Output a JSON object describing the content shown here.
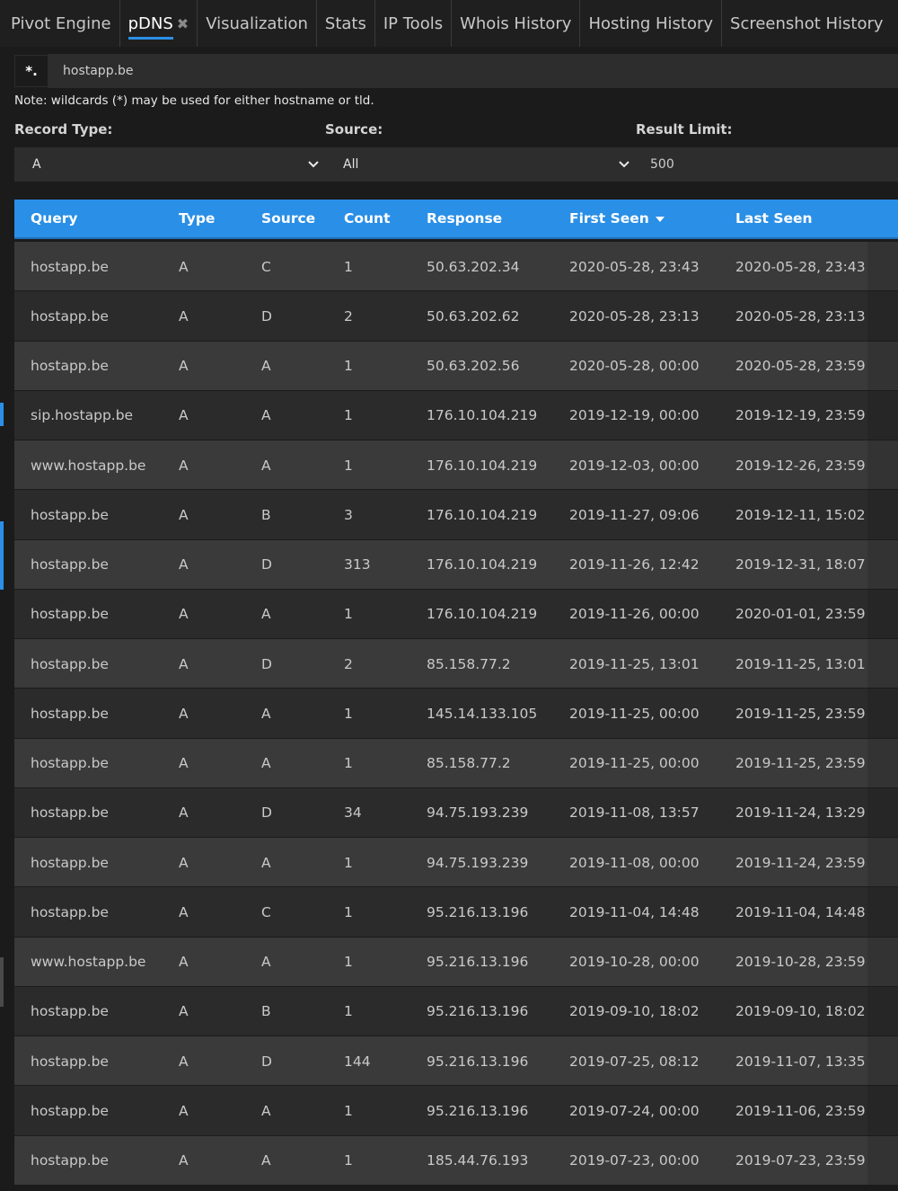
{
  "tabs": [
    {
      "label": "Pivot Engine",
      "active": false
    },
    {
      "label": "pDNS",
      "active": true,
      "closable": true
    },
    {
      "label": "Visualization",
      "active": false
    },
    {
      "label": "Stats",
      "active": false
    },
    {
      "label": "IP Tools",
      "active": false
    },
    {
      "label": "Whois History",
      "active": false
    },
    {
      "label": "Hosting History",
      "active": false
    },
    {
      "label": "Screenshot History",
      "active": false
    }
  ],
  "search": {
    "wildcard_label": "*.",
    "value": "hostapp.be"
  },
  "note": "Note: wildcards (*) may be used for either hostname or tld.",
  "filters": {
    "record_type_label": "Record Type:",
    "record_type_value": "A",
    "source_label": "Source:",
    "source_value": "All",
    "result_limit_label": "Result Limit:",
    "result_limit_value": "500"
  },
  "table": {
    "columns": [
      "Query",
      "Type",
      "Source",
      "Count",
      "Response",
      "First Seen",
      "Last Seen"
    ],
    "sorted_column": "First Seen",
    "rows": [
      [
        "hostapp.be",
        "A",
        "C",
        "1",
        "50.63.202.34",
        "2020-05-28, 23:43",
        "2020-05-28, 23:43"
      ],
      [
        "hostapp.be",
        "A",
        "D",
        "2",
        "50.63.202.62",
        "2020-05-28, 23:13",
        "2020-05-28, 23:13"
      ],
      [
        "hostapp.be",
        "A",
        "A",
        "1",
        "50.63.202.56",
        "2020-05-28, 00:00",
        "2020-05-28, 23:59"
      ],
      [
        "sip.hostapp.be",
        "A",
        "A",
        "1",
        "176.10.104.219",
        "2019-12-19, 00:00",
        "2019-12-19, 23:59"
      ],
      [
        "www.hostapp.be",
        "A",
        "A",
        "1",
        "176.10.104.219",
        "2019-12-03, 00:00",
        "2019-12-26, 23:59"
      ],
      [
        "hostapp.be",
        "A",
        "B",
        "3",
        "176.10.104.219",
        "2019-11-27, 09:06",
        "2019-12-11, 15:02"
      ],
      [
        "hostapp.be",
        "A",
        "D",
        "313",
        "176.10.104.219",
        "2019-11-26, 12:42",
        "2019-12-31, 18:07"
      ],
      [
        "hostapp.be",
        "A",
        "A",
        "1",
        "176.10.104.219",
        "2019-11-26, 00:00",
        "2020-01-01, 23:59"
      ],
      [
        "hostapp.be",
        "A",
        "D",
        "2",
        "85.158.77.2",
        "2019-11-25, 13:01",
        "2019-11-25, 13:01"
      ],
      [
        "hostapp.be",
        "A",
        "A",
        "1",
        "145.14.133.105",
        "2019-11-25, 00:00",
        "2019-11-25, 23:59"
      ],
      [
        "hostapp.be",
        "A",
        "A",
        "1",
        "85.158.77.2",
        "2019-11-25, 00:00",
        "2019-11-25, 23:59"
      ],
      [
        "hostapp.be",
        "A",
        "D",
        "34",
        "94.75.193.239",
        "2019-11-08, 13:57",
        "2019-11-24, 13:29"
      ],
      [
        "hostapp.be",
        "A",
        "A",
        "1",
        "94.75.193.239",
        "2019-11-08, 00:00",
        "2019-11-24, 23:59"
      ],
      [
        "hostapp.be",
        "A",
        "C",
        "1",
        "95.216.13.196",
        "2019-11-04, 14:48",
        "2019-11-04, 14:48"
      ],
      [
        "www.hostapp.be",
        "A",
        "A",
        "1",
        "95.216.13.196",
        "2019-10-28, 00:00",
        "2019-10-28, 23:59"
      ],
      [
        "hostapp.be",
        "A",
        "B",
        "1",
        "95.216.13.196",
        "2019-09-10, 18:02",
        "2019-09-10, 18:02"
      ],
      [
        "hostapp.be",
        "A",
        "D",
        "144",
        "95.216.13.196",
        "2019-07-25, 08:12",
        "2019-11-07, 13:35"
      ],
      [
        "hostapp.be",
        "A",
        "A",
        "1",
        "95.216.13.196",
        "2019-07-24, 00:00",
        "2019-11-06, 23:59"
      ],
      [
        "hostapp.be",
        "A",
        "A",
        "1",
        "185.44.76.193",
        "2019-07-23, 00:00",
        "2019-07-23, 23:59"
      ]
    ]
  },
  "colors": {
    "accent": "#2a8fe6",
    "background": "#1b1b1b",
    "row_light": "#3a3a3a",
    "row_dark": "#2b2b2b"
  }
}
